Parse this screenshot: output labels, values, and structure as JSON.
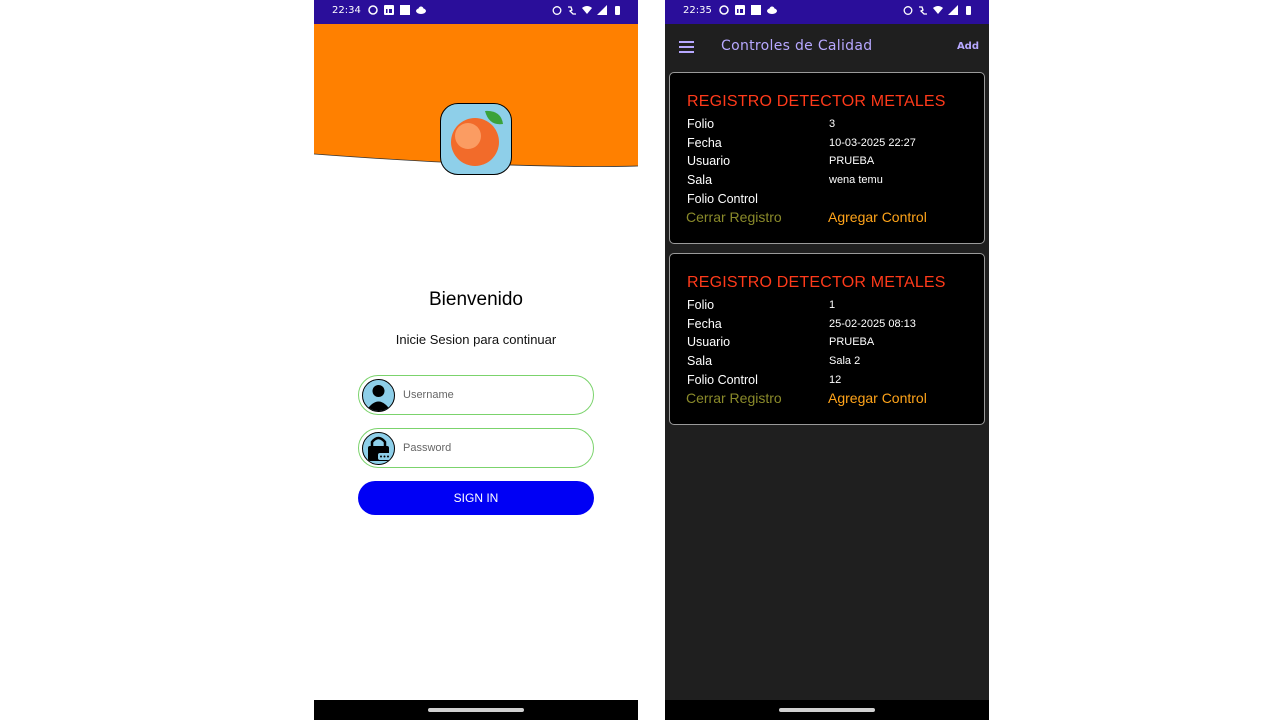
{
  "login_screen": {
    "status_time": "22:34",
    "welcome": "Bienvenido",
    "subtitle": "Inicie Sesion para continuar",
    "username_placeholder": "Username",
    "password_placeholder": "Password",
    "signin_label": "SIGN IN",
    "colors": {
      "hero": "#ff8000",
      "signin": "#0000f5",
      "field_border": "#7bd36c",
      "icon_bg": "#8ecfe9"
    }
  },
  "list_screen": {
    "status_time": "22:35",
    "title": "Controles de Calidad",
    "add_label": "Add",
    "labels": {
      "folio": "Folio",
      "fecha": "Fecha",
      "usuario": "Usuario",
      "sala": "Sala",
      "folio_control": "Folio Control"
    },
    "cards": [
      {
        "title": "REGISTRO DETECTOR METALES",
        "folio": "3",
        "fecha": "10-03-2025 22:27",
        "usuario": "PRUEBA",
        "sala": "wena temu",
        "folio_control": "",
        "close_label": "Cerrar Registro",
        "add_control_label": "Agregar Control"
      },
      {
        "title": "REGISTRO DETECTOR METALES",
        "folio": "1",
        "fecha": "25-02-2025 08:13",
        "usuario": "PRUEBA",
        "sala": "Sala 2",
        "folio_control": "12",
        "close_label": "Cerrar Registro",
        "add_control_label": "Agregar Control"
      }
    ],
    "colors": {
      "statusbar": "#2a0e9a",
      "accent": "#b7a8ff",
      "card_title": "#ff3a1a",
      "close_action": "#8a8a2a",
      "add_action": "#ffa41a"
    }
  }
}
